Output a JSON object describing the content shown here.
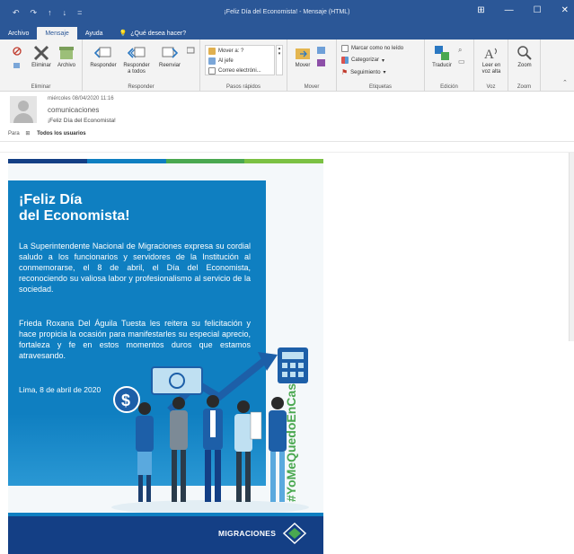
{
  "window": {
    "title": "¡Feliz Día del Economista! - Mensaje (HTML)",
    "quick_access": [
      "↶",
      "↷",
      "↑",
      "↓",
      "="
    ],
    "controls": [
      "⊞",
      "—",
      "☐",
      "✕"
    ]
  },
  "tabs": [
    {
      "label": "Archivo"
    },
    {
      "label": "Mensaje"
    },
    {
      "label": "Ayuda"
    },
    {
      "label": "¿Qué desea hacer?"
    }
  ],
  "ribbon": {
    "eliminar_group": {
      "label": "Eliminar",
      "eliminar": "Eliminar",
      "archivo": "Archivo"
    },
    "responder_group": {
      "label": "Responder",
      "responder": "Responder",
      "responder_todos_1": "Responder",
      "responder_todos_2": "a todos",
      "reenviar": "Reenviar"
    },
    "pasos_group": {
      "label": "Pasos rápidos",
      "items": [
        "Mover a: ?",
        "Al jefe",
        "Correo electróni..."
      ]
    },
    "mover_group": {
      "label": "Mover",
      "mover": "Mover"
    },
    "etiquetas_group": {
      "label": "Etiquetas",
      "items": [
        "Marcar como no leído",
        "Categorizar",
        "Seguimiento"
      ]
    },
    "edicion_group": {
      "label": "Edición",
      "traducir": "Traducir"
    },
    "voz_group": {
      "label": "Voz",
      "leer_1": "Leer en",
      "leer_2": "voz alta"
    },
    "zoom_group": {
      "label": "Zoom",
      "zoom": "Zoom"
    }
  },
  "message": {
    "date": "miércoles 08/04/2020 11:16",
    "sender": "comunicaciones",
    "subject": "¡Feliz Día del Economista!",
    "to_label": "Para",
    "to_value": "Todos los usuarios"
  },
  "card": {
    "headline_1": "¡Feliz Día",
    "headline_2": "del Economista!",
    "paragraph_1": "La Superintendente Nacional de Migraciones expresa su cordial saludo a los funcionarios y servidores de la Institución al conmemorarse, el 8 de abril, el Día del Economista, reconociendo su valiosa labor y profesionalismo al servicio de la sociedad.",
    "paragraph_2": "Frieda Roxana Del Águila Tuesta les reitera su felicitación y hace propicia la ocasión para manifestarles su especial aprecio, fortaleza y fe en estos momentos duros que estamos atravesando.",
    "dateline": "Lima, 8 de abril de 2020",
    "hashtag": "#YoMeQuedoEnCasa",
    "logo": "MIGRACIONES",
    "stripe_colors": [
      "#143f85",
      "#0f7fc1",
      "#4aa850",
      "#7bc143"
    ],
    "panel_color": "#0f7fc1",
    "hashtag_color": "#4aa850"
  }
}
